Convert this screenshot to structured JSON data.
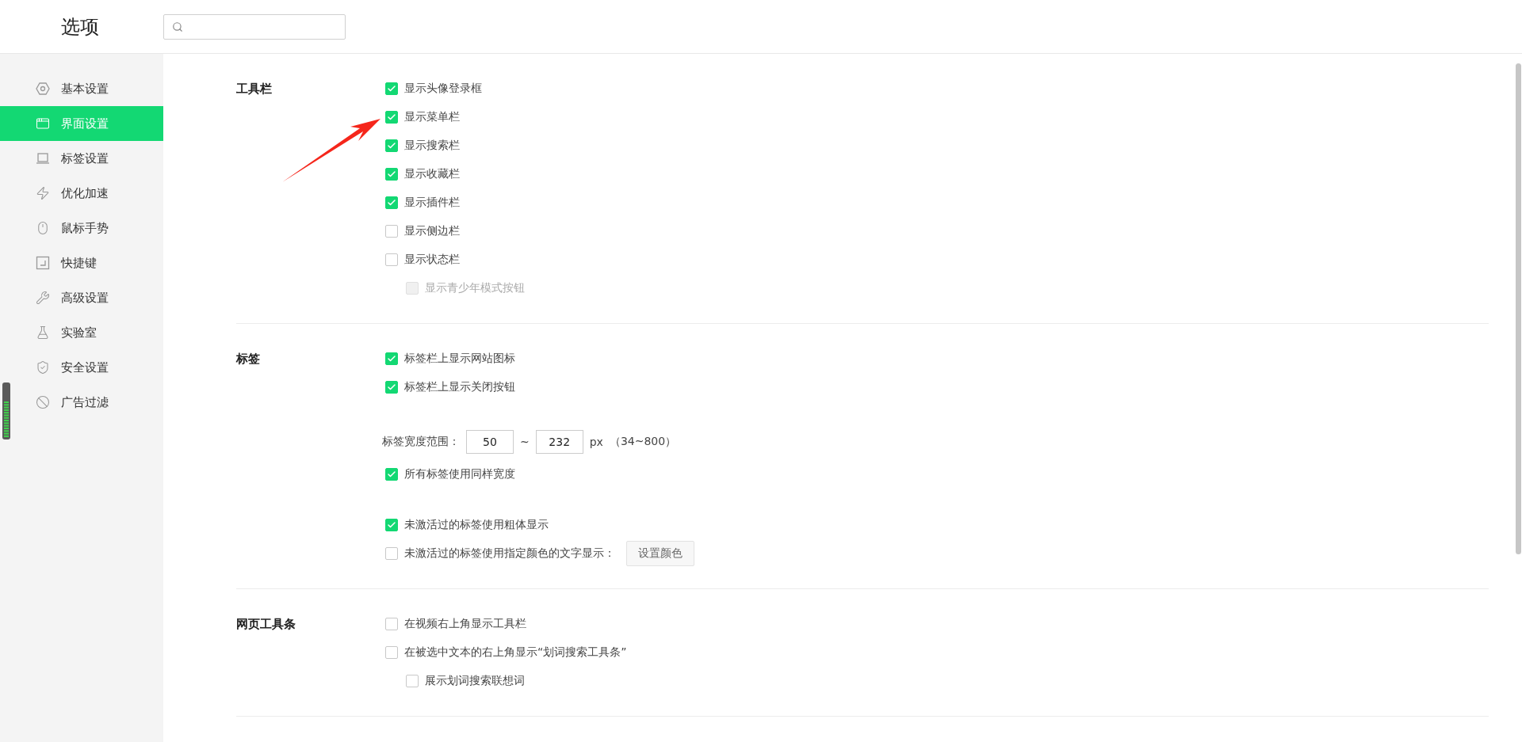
{
  "window": {
    "title": "选项"
  },
  "sidebar": {
    "items": [
      {
        "label": "基本设置",
        "selected": false
      },
      {
        "label": "界面设置",
        "selected": true
      },
      {
        "label": "标签设置",
        "selected": false
      },
      {
        "label": "优化加速",
        "selected": false
      },
      {
        "label": "鼠标手势",
        "selected": false
      },
      {
        "label": "快捷键",
        "selected": false
      },
      {
        "label": "高级设置",
        "selected": false
      },
      {
        "label": "实验室",
        "selected": false
      },
      {
        "label": "安全设置",
        "selected": false
      },
      {
        "label": "广告过滤",
        "selected": false
      }
    ]
  },
  "sections": [
    {
      "title": "工具栏",
      "groups": [
        [
          {
            "kind": "checkbox",
            "label": "显示头像登录框",
            "checked": true
          },
          {
            "kind": "checkbox",
            "label": "显示菜单栏",
            "checked": true
          },
          {
            "kind": "checkbox",
            "label": "显示搜索栏",
            "checked": true
          },
          {
            "kind": "checkbox",
            "label": "显示收藏栏",
            "checked": true
          },
          {
            "kind": "checkbox",
            "label": "显示插件栏",
            "checked": true
          },
          {
            "kind": "checkbox",
            "label": "显示侧边栏",
            "checked": false
          },
          {
            "kind": "checkbox",
            "label": "显示状态栏",
            "checked": false,
            "children": [
              {
                "kind": "checkbox",
                "label": "显示青少年模式按钮",
                "checked": false,
                "disabled": true
              }
            ]
          }
        ]
      ]
    },
    {
      "title": "标签",
      "groups": [
        [
          {
            "kind": "checkbox",
            "label": "标签栏上显示网站图标",
            "checked": true
          },
          {
            "kind": "checkbox",
            "label": "标签栏上显示关闭按钮",
            "checked": true
          }
        ],
        [
          {
            "kind": "range",
            "label": "标签宽度范围：",
            "min": "50",
            "separator": "~",
            "max": "232",
            "unit": "px",
            "hint": "（34~800）"
          },
          {
            "kind": "checkbox",
            "label": "所有标签使用同样宽度",
            "checked": true
          }
        ],
        [
          {
            "kind": "checkbox",
            "label": "未激活过的标签使用粗体显示",
            "checked": true
          },
          {
            "kind": "checkbox",
            "label": "未激活过的标签使用指定颜色的文字显示：",
            "checked": false,
            "button": "设置颜色"
          }
        ]
      ]
    },
    {
      "title": "网页工具条",
      "groups": [
        [
          {
            "kind": "checkbox",
            "label": "在视频右上角显示工具栏",
            "checked": false
          },
          {
            "kind": "checkbox",
            "label": "在被选中文本的右上角显示“划词搜索工具条”",
            "checked": false,
            "children": [
              {
                "kind": "checkbox",
                "label": "展示划词搜索联想词",
                "checked": false
              }
            ]
          }
        ]
      ]
    }
  ]
}
